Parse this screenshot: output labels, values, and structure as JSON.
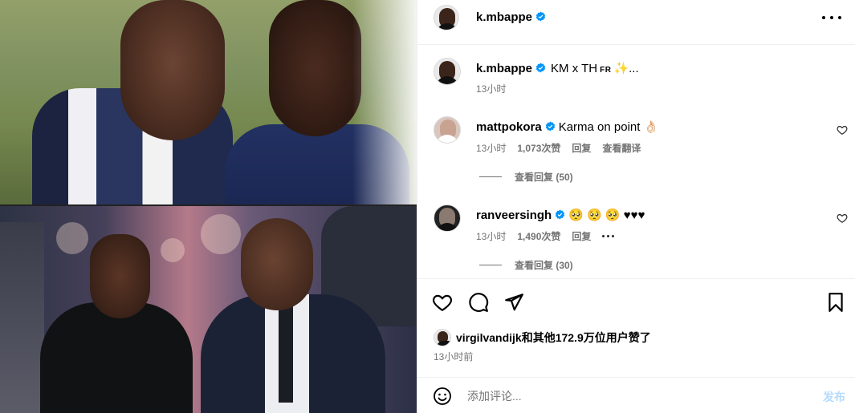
{
  "post": {
    "author": "k.mbappe",
    "author_verified": true,
    "caption_prefix": "KM x TH",
    "caption_flag": "FR",
    "caption_emoji": "✨",
    "caption_suffix": "...",
    "caption_time": "13小时"
  },
  "comments": [
    {
      "user": "mattpokora",
      "verified": true,
      "text": "Karma on point 👌🏻",
      "time": "13小时",
      "likes": "1,073次赞",
      "reply": "回复",
      "translate": "查看翻译",
      "view_replies": "查看回复 (50)"
    },
    {
      "user": "ranveersingh",
      "verified": true,
      "text": "🥺 🥺 🥺 ♥♥♥",
      "time": "13小时",
      "likes": "1,490次赞",
      "reply": "回复",
      "view_replies": "查看回复 (30)"
    }
  ],
  "likes_line": {
    "user": "virgilvandijk",
    "rest": "和其他172.9万位用户赞了"
  },
  "date": "13小时前",
  "add_comment": {
    "placeholder": "添加评论...",
    "post_label": "发布"
  },
  "icons": {
    "verified_color": "#0095f6",
    "post_disabled_color": "#b3dbff"
  }
}
